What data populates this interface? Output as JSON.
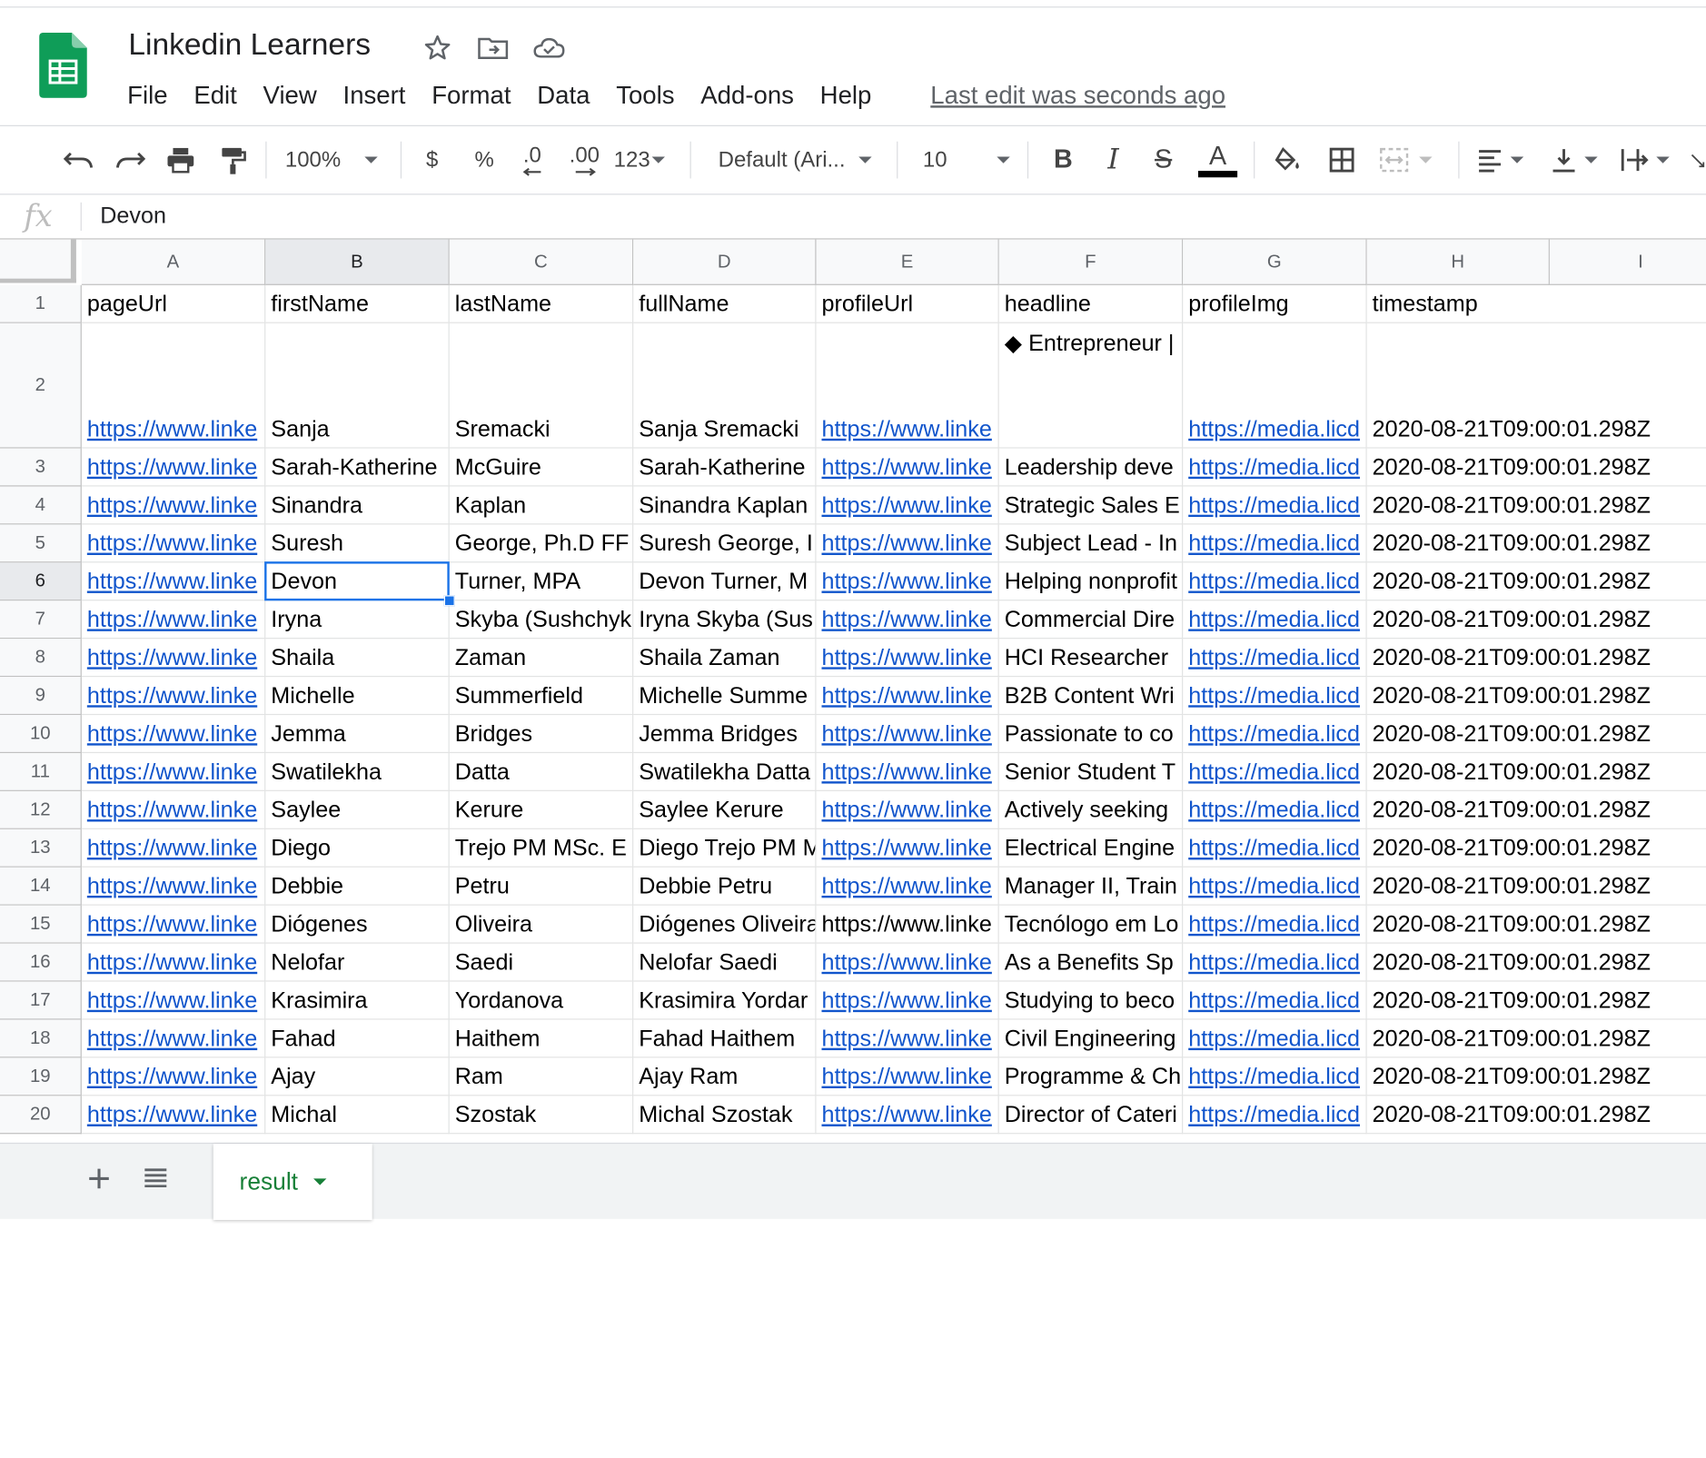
{
  "doc": {
    "title": "Linkedin Learners",
    "last_edit": "Last edit was seconds ago"
  },
  "menu": [
    "File",
    "Edit",
    "View",
    "Insert",
    "Format",
    "Data",
    "Tools",
    "Add-ons",
    "Help"
  ],
  "toolbar": {
    "zoom": "100%",
    "currency": "$",
    "percent": "%",
    "decrease_decimal": ".0",
    "increase_decimal": ".00",
    "more_formats": "123",
    "font": "Default (Ari...",
    "font_size": "10",
    "bold": "B",
    "italic": "I",
    "strike": "S",
    "text_color_letter": "A",
    "text_color": "#000000"
  },
  "formula_bar": {
    "fx": "fx",
    "value": "Devon"
  },
  "columns": [
    "A",
    "B",
    "C",
    "D",
    "E",
    "F",
    "G",
    "H",
    "I"
  ],
  "active_cell": {
    "row": 6,
    "col": "B"
  },
  "rows": [
    {
      "num": "1",
      "cells": [
        "pageUrl",
        "firstName",
        "lastName",
        "fullName",
        "profileUrl",
        "headline",
        "profileImg",
        "timestamp",
        ""
      ]
    },
    {
      "num": "2",
      "cells": [
        "https://www.linke",
        "Sanja",
        "Sremacki",
        "Sanja Sremacki",
        "https://www.linke",
        "◆ Entrepreneur |",
        "https://media.licd",
        "2020-08-21T09:00:01.298Z",
        ""
      ]
    },
    {
      "num": "3",
      "cells": [
        "https://www.linke",
        "Sarah-Katherine",
        "McGuire",
        "Sarah-Katherine",
        "https://www.linke",
        "Leadership deve",
        "https://media.licd",
        "2020-08-21T09:00:01.298Z",
        ""
      ]
    },
    {
      "num": "4",
      "cells": [
        "https://www.linke",
        "Sinandra",
        "Kaplan",
        "Sinandra Kaplan",
        "https://www.linke",
        "Strategic Sales E",
        "https://media.licd",
        "2020-08-21T09:00:01.298Z",
        ""
      ]
    },
    {
      "num": "5",
      "cells": [
        "https://www.linke",
        "Suresh",
        "George, Ph.D FF",
        "Suresh George, I",
        "https://www.linke",
        "Subject Lead - In",
        "https://media.licd",
        "2020-08-21T09:00:01.298Z",
        ""
      ]
    },
    {
      "num": "6",
      "cells": [
        "https://www.linke",
        "Devon",
        "Turner, MPA",
        "Devon Turner, M",
        "https://www.linke",
        "Helping nonprofit",
        "https://media.licd",
        "2020-08-21T09:00:01.298Z",
        ""
      ]
    },
    {
      "num": "7",
      "cells": [
        "https://www.linke",
        "Iryna",
        "Skyba (Sushchyk",
        "Iryna Skyba (Sus",
        "https://www.linke",
        "Commercial Dire",
        "https://media.licd",
        "2020-08-21T09:00:01.298Z",
        ""
      ]
    },
    {
      "num": "8",
      "cells": [
        "https://www.linke",
        "Shaila",
        "Zaman",
        "Shaila Zaman",
        "https://www.linke",
        "HCI Researcher",
        "https://media.licd",
        "2020-08-21T09:00:01.298Z",
        ""
      ]
    },
    {
      "num": "9",
      "cells": [
        "https://www.linke",
        "Michelle",
        "Summerfield",
        "Michelle Summe",
        "https://www.linke",
        "B2B Content Wri",
        "https://media.licd",
        "2020-08-21T09:00:01.298Z",
        ""
      ]
    },
    {
      "num": "10",
      "cells": [
        "https://www.linke",
        "Jemma",
        "Bridges",
        "Jemma Bridges",
        "https://www.linke",
        "Passionate to co",
        "https://media.licd",
        "2020-08-21T09:00:01.298Z",
        ""
      ]
    },
    {
      "num": "11",
      "cells": [
        "https://www.linke",
        "Swatilekha",
        "Datta",
        "Swatilekha Datta",
        "https://www.linke",
        "Senior Student T",
        "https://media.licd",
        "2020-08-21T09:00:01.298Z",
        ""
      ]
    },
    {
      "num": "12",
      "cells": [
        "https://www.linke",
        "Saylee",
        "Kerure",
        "Saylee Kerure",
        "https://www.linke",
        "Actively seeking",
        "https://media.licd",
        "2020-08-21T09:00:01.298Z",
        ""
      ]
    },
    {
      "num": "13",
      "cells": [
        "https://www.linke",
        "Diego",
        "Trejo PM MSc. E",
        "Diego Trejo PM M",
        "https://www.linke",
        "Electrical Engine",
        "https://media.licd",
        "2020-08-21T09:00:01.298Z",
        ""
      ]
    },
    {
      "num": "14",
      "cells": [
        "https://www.linke",
        "Debbie",
        "Petru",
        "Debbie Petru",
        "https://www.linke",
        "Manager II, Train",
        "https://media.licd",
        "2020-08-21T09:00:01.298Z",
        ""
      ]
    },
    {
      "num": "15",
      "cells": [
        "https://www.linke",
        "Diógenes",
        "Oliveira",
        "Diógenes Oliveira",
        "https://www.linke",
        "Tecnólogo em Lo",
        "https://media.licd",
        "2020-08-21T09:00:01.298Z",
        ""
      ]
    },
    {
      "num": "16",
      "cells": [
        "https://www.linke",
        "Nelofar",
        "Saedi",
        "Nelofar Saedi",
        "https://www.linke",
        "As a Benefits Sp",
        "https://media.licd",
        "2020-08-21T09:00:01.298Z",
        ""
      ]
    },
    {
      "num": "17",
      "cells": [
        "https://www.linke",
        "Krasimira",
        "Yordanova",
        "Krasimira Yordar",
        "https://www.linke",
        "Studying to beco",
        "https://media.licd",
        "2020-08-21T09:00:01.298Z",
        ""
      ]
    },
    {
      "num": "18",
      "cells": [
        "https://www.linke",
        "Fahad",
        "Haithem",
        "Fahad Haithem",
        "https://www.linke",
        "Civil Engineering",
        "https://media.licd",
        "2020-08-21T09:00:01.298Z",
        ""
      ]
    },
    {
      "num": "19",
      "cells": [
        "https://www.linke",
        "Ajay",
        "Ram",
        "Ajay Ram",
        "https://www.linke",
        "Programme & Ch",
        "https://media.licd",
        "2020-08-21T09:00:01.298Z",
        ""
      ]
    },
    {
      "num": "20",
      "cells": [
        "https://www.linke",
        "Michal",
        "Szostak",
        "Michal Szostak",
        "https://www.linke",
        "Director of Cateri",
        "https://media.licd",
        "2020-08-21T09:00:01.298Z",
        ""
      ]
    }
  ],
  "sheets": [
    {
      "name": "result",
      "active": true
    }
  ]
}
